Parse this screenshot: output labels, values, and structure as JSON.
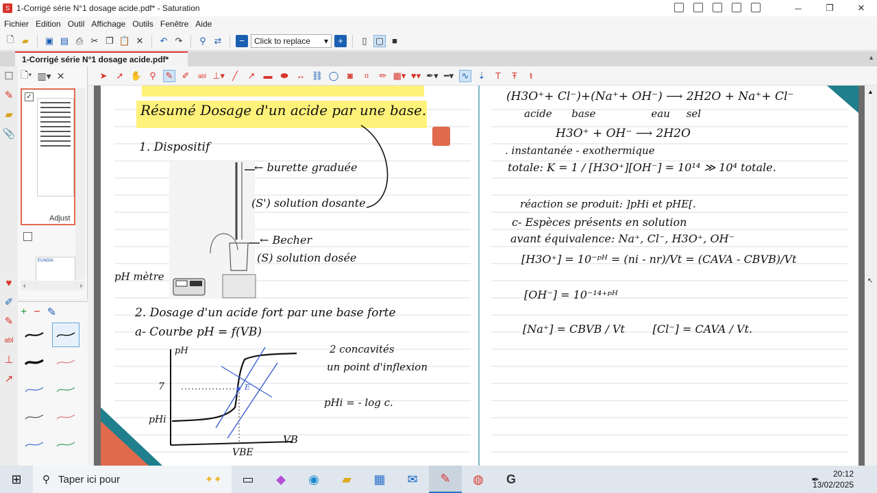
{
  "window": {
    "title": "1-Corrigé série N°1 dosage acide.pdf* - Saturation",
    "controls": {
      "minimize": "─",
      "restore": "❐",
      "close": "✕"
    }
  },
  "menu": [
    "Fichier",
    "Edition",
    "Outil",
    "Affichage",
    "Outils",
    "Fenêtre",
    "Aide"
  ],
  "toolbar": {
    "replace_value": "Click to replace",
    "replace_arrow": "▾"
  },
  "tab": {
    "label": "1-Corrigé série N°1 dosage acide.pdf*"
  },
  "thumbnails": {
    "page1_label": "Adjust",
    "page2_caption": "EUNOIA"
  },
  "notes": {
    "left": {
      "title": "Résumé Dosage d'un acide par une base.",
      "section1": "1. Dispositif",
      "burette": "← burette graduée",
      "solution_dosante": "(S')  solution dosante",
      "becher": "← Becher",
      "solution_dosee": "(S)  solution dosée",
      "ph_metre": "pH mètre",
      "section2": "2. Dosage d'un acide fort par une base forte",
      "courbe": "a- Courbe  pH = f(VB)",
      "concavites": "2 concavités",
      "inflexion": "un point d'inflexion",
      "phi": "pHi = - log c.",
      "axis_y": "pH",
      "axis_x": "VB",
      "tick_7": "7",
      "tick_phi": "pHi",
      "tick_vbe": "VBE",
      "point_e": "E"
    },
    "right": {
      "line1": "(H3O⁺+ Cl⁻)+(Na⁺+ OH⁻)  ⟶  2H2O + Na⁺+ Cl⁻",
      "line2": "acide      base                 eau     sel",
      "line3": "H3O⁺ + OH⁻  ⟶  2H2O",
      "line4": ". instantanée - exothermique",
      "line5": "totale:  K = 1 / [H3O⁺][OH⁻] = 10¹⁴ ≫ 10⁴ totale.",
      "line6": "réaction se produit: ]pHi et pHE[.",
      "line7": "c- Espèces présents en solution",
      "line8": "avant équivalence: Na⁺, Cl⁻, H3O⁺, OH⁻",
      "line9": "[H3O⁺] = 10⁻ᵖᴴ = (ni - nr)/Vt = (CAVA - CBVB)/Vt",
      "line10": "[OH⁻] = 10⁻¹⁴⁺ᵖᴴ",
      "line11": "[Na⁺] = CBVB / Vt        [Cl⁻] = CAVA / Vt."
    }
  },
  "taskbar": {
    "search_placeholder": "Taper ici pour",
    "time": "20:12",
    "date": "13/02/2025"
  },
  "colors": {
    "accent": "#d9342b",
    "highlight": "#fff27a",
    "divider": "#7fb6c7",
    "curve_blue": "#3a5fd0"
  }
}
